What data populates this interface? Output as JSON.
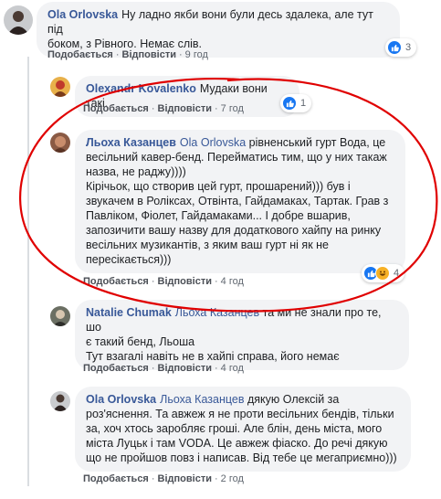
{
  "comments": [
    {
      "author": "Ola Orlovska",
      "mention": "",
      "lines": [
        "Ну ладно якби вони були десь здалека, але тут під",
        "боком, з Рівного. Немає слів."
      ],
      "like": "Подобається",
      "reply": "Відповісти",
      "time": "9 год",
      "reaction_count": "3"
    },
    {
      "author": "Olexandr Kovalenko",
      "mention": "",
      "lines": [
        "Мудаки вони такі."
      ],
      "like": "Подобається",
      "reply": "Відповісти",
      "time": "7 год",
      "reaction_count": "1"
    },
    {
      "author": "Льоха Казанцев",
      "mention": "Ola Orlovska",
      "first_line_rest": "рівненський гурт Вода, це",
      "lines": [
        "весільний кавер-бенд. Перейматись тим, що у них такаж",
        "назва, не раджу))))",
        "Кірічьок, що створив цей гурт, прошарений))) був і",
        "звукачем в Ролiксах, Отвінта, Гайдамаках, Тартак. Грав з",
        "Павліком, Фіолет, Гайдамаками... І добре вшарив,",
        "запозичити вашу назву для додаткового хайпу на ринку",
        "весільних музикантів, з яким ваш гурт ні як не",
        "пересікається)))"
      ],
      "like": "Подобається",
      "reply": "Відповісти",
      "time": "4 год",
      "reaction_count": "4"
    },
    {
      "author": "Natalie Chumak",
      "mention": "Льоха Казанцев",
      "first_line_rest": "та ми не знали про те, шо",
      "lines": [
        "є такий бенд, Льоша",
        "Тут взагалі навіть не в хайпі справа, його немає"
      ],
      "like": "Подобається",
      "reply": "Відповісти",
      "time": "4 год",
      "reaction_count": ""
    },
    {
      "author": "Ola Orlovska",
      "mention": "Льоха Казанцев",
      "first_line_rest": "дякую Олексій за",
      "lines": [
        "роз'яснення. Та авжеж я не проти весільних бендів, тільки",
        "за, хоч хтось заробляє гроші. Але блін, день міста, мого",
        "міста Луцьк і там VODA. Це авжеж фіаско. До речі дякую",
        "що не пройшов повз і написав. Від тебе це мегаприємно)))"
      ],
      "like": "Подобається",
      "reply": "Відповісти",
      "time": "2 год",
      "reaction_count": ""
    }
  ],
  "separator": "·",
  "colors": {
    "link": "#385898",
    "bubble": "#f2f3f5",
    "like_blue": "#1877f2",
    "annotation_red": "#e00000"
  }
}
